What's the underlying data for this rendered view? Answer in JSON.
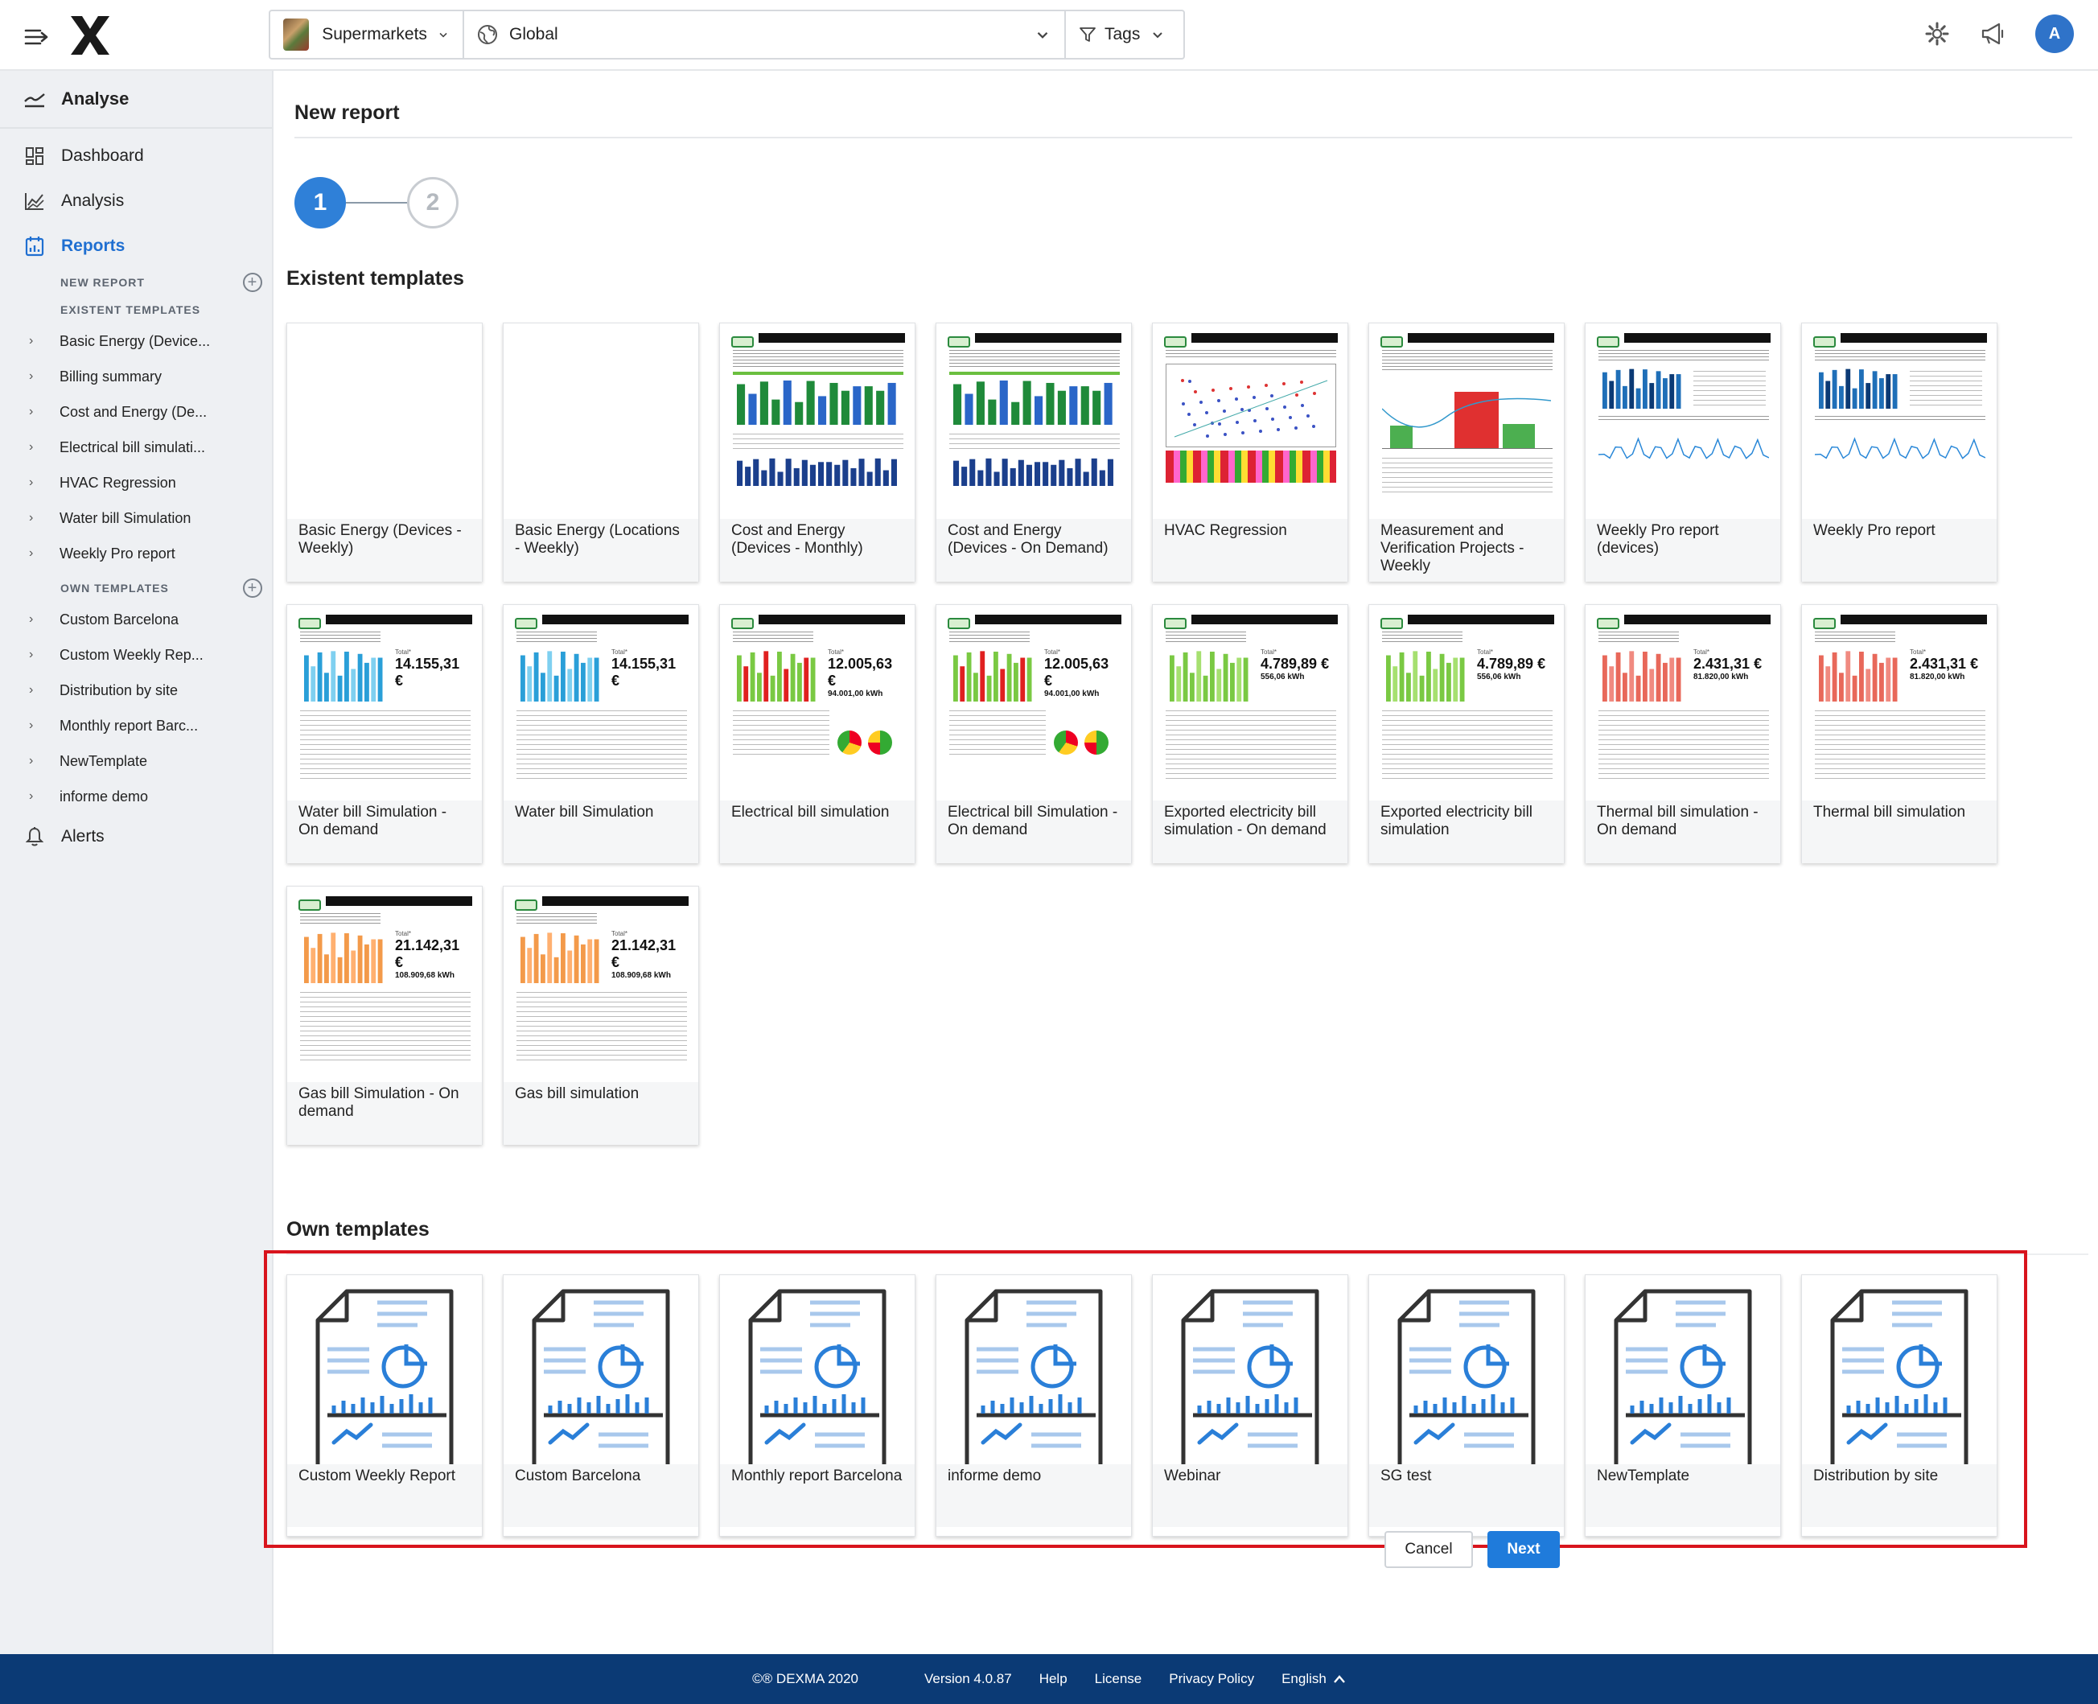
{
  "topbar": {
    "organization": "Supermarkets",
    "location": "Global",
    "tags_label": "Tags",
    "avatar_initial": "A"
  },
  "sidebar": {
    "analyse_label": "Analyse",
    "dashboard_label": "Dashboard",
    "analysis_label": "Analysis",
    "reports_label": "Reports",
    "new_report_label": "NEW REPORT",
    "existent_templates_label": "EXISTENT TEMPLATES",
    "existent_items": [
      "Basic Energy (Device...",
      "Billing summary",
      "Cost and Energy (De...",
      "Electrical bill simulati...",
      "HVAC Regression",
      "Water bill Simulation",
      "Weekly Pro report"
    ],
    "own_templates_label": "OWN TEMPLATES",
    "own_items": [
      "Custom Barcelona",
      "Custom Weekly Rep...",
      "Distribution by site",
      "Monthly report Barc...",
      "NewTemplate",
      "informe demo"
    ],
    "alerts_label": "Alerts"
  },
  "main": {
    "title": "New report",
    "steps": [
      "1",
      "2"
    ],
    "existent_title": "Existent templates",
    "own_title": "Own templates",
    "existent_templates": [
      "Basic Energy (Devices - Weekly)",
      "Basic Energy (Locations - Weekly)",
      "Cost and Energy (Devices - Monthly)",
      "Cost and Energy (Devices - On Demand)",
      "HVAC Regression",
      "Measurement and Verification Projects - Weekly",
      "Weekly Pro report (devices)",
      "Weekly Pro report",
      "Water bill Simulation - On demand",
      "Water bill Simulation",
      "Electrical bill simulation",
      "Electrical bill Simulation - On demand",
      "Exported electricity bill simulation - On demand",
      "Exported electricity bill simulation",
      "Thermal bill simulation - On demand",
      "Thermal bill simulation",
      "Gas bill Simulation - On demand",
      "Gas bill simulation"
    ],
    "thumb_values": {
      "water": "14.155,31 €",
      "electrical": "12.005,63 €",
      "electrical_kwh": "94.001,00 kWh",
      "exported": "4.789,89 €",
      "exported_kwh": "556,06 kWh",
      "thermal": "2.431,31 €",
      "thermal_kwh": "81.820,00 kWh",
      "gas": "21.142,31 €",
      "gas_kwh": "108.909,68 kWh"
    },
    "own_templates": [
      "Custom Weekly Report",
      "Custom Barcelona",
      "Monthly report Barcelona",
      "informe demo",
      "Webinar",
      "SG test",
      "NewTemplate",
      "Distribution by site"
    ],
    "cancel_label": "Cancel",
    "next_label": "Next"
  },
  "footer": {
    "copyright": "©® DEXMA 2020",
    "version": "Version 4.0.87",
    "help": "Help",
    "license": "License",
    "privacy": "Privacy Policy",
    "language": "English"
  },
  "colors": {
    "accent": "#1f7bdb",
    "footer_bg": "#0b3a75",
    "highlight_border": "#d8141d",
    "water_bars": "#2a9fd8",
    "electrical_bars": "#7ac943",
    "thermal_bars": "#e8685a",
    "gas_bars": "#f39a4a"
  }
}
